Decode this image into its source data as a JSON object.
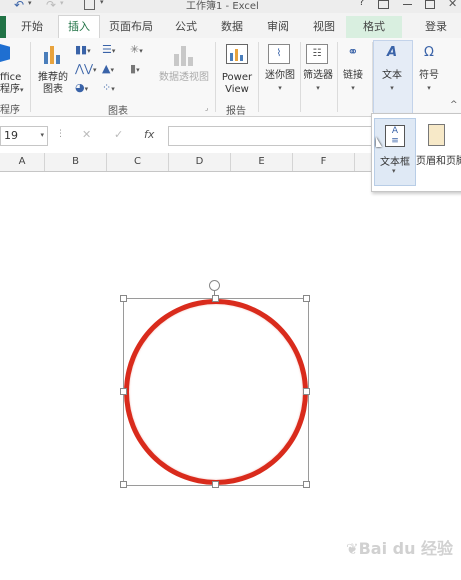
{
  "window": {
    "title": "工作簿1 - Excel",
    "help": "?",
    "login": "登录"
  },
  "tabs": [
    "开始",
    "插入",
    "页面布局",
    "公式",
    "数据",
    "审阅",
    "视图",
    "格式"
  ],
  "ribbon": {
    "office_btn_line1": "ffice",
    "office_btn_line2": "程序",
    "recommended_chart_line1": "推荐的",
    "recommended_chart_line2": "图表",
    "pivot_chart": "数据透视图",
    "power_view_line1": "Power",
    "power_view_line2": "View",
    "sparkline": "迷你图",
    "filter": "筛选器",
    "link": "链接",
    "text": "文本",
    "symbol": "符号",
    "group_charts": "图表",
    "group_reports": "报告",
    "group_apps": "程序"
  },
  "formula_bar": {
    "name_box": "19",
    "fx_label": "fx",
    "cancel": "✕",
    "confirm": "✓"
  },
  "columns": [
    "A",
    "B",
    "C",
    "D",
    "E",
    "F"
  ],
  "text_menu": {
    "textbox": "文本框",
    "header_footer": "页眉和页脚"
  },
  "shape": {
    "stroke_color": "#d92b1c",
    "type": "circle"
  },
  "watermark": {
    "text": "Bai du 经验"
  }
}
